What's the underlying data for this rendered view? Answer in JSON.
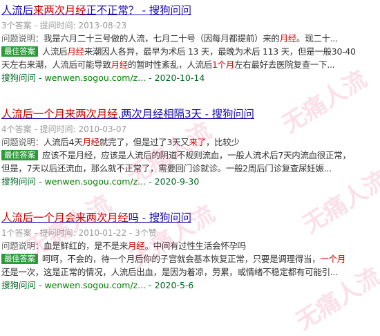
{
  "labels": {
    "question_label": "问题说明：",
    "best_answer_badge": "最佳答案",
    "ellipsis": "...",
    "dash": " - "
  },
  "watermark": "无痛人流",
  "results": [
    {
      "title_parts": [
        {
          "text": "人流后",
          "hl": false
        },
        {
          "text": "来两次月经",
          "hl": true
        },
        {
          "text": "正不正常？ - 搜狗问问",
          "hl": false
        }
      ],
      "meta": "3个答案 - 提问时间: 2013-08-23",
      "question_parts": [
        {
          "text": "我是六月二十三号做的人流，七月二十号（因每月都提前）来的",
          "hl": false
        },
        {
          "text": "月经",
          "hl": true
        },
        {
          "text": "。现二十...",
          "hl": false
        }
      ],
      "answer_line1_parts": [
        {
          "text": "人流后",
          "hl": false
        },
        {
          "text": "月经",
          "hl": true
        },
        {
          "text": "来潮因人各异，最早为术后 13 天，最晚为术后 113 天，但是一般30-40",
          "hl": false
        }
      ],
      "answer_line2_parts": [
        {
          "text": "天左右来潮，人流后可能导致",
          "hl": false
        },
        {
          "text": "月经",
          "hl": true
        },
        {
          "text": "的暂时性紊乱，人流后",
          "hl": false
        },
        {
          "text": "1个月",
          "hl": true
        },
        {
          "text": "左右最好去医院复查一下...",
          "hl": false
        }
      ],
      "source_site": "搜狗问问",
      "source_url": "wenwen.sogou.com/z...",
      "source_date": "2020-10-14"
    },
    {
      "title_parts": [
        {
          "text": "人流后一个月来两次月经",
          "hl": true
        },
        {
          "text": ",两次月经相隔3天 - 搜狗问问",
          "hl": false
        }
      ],
      "meta": "4个答案 - 提问时间: 2010-03-07",
      "question_parts": [
        {
          "text": "人流后4天",
          "hl": false
        },
        {
          "text": "月经",
          "hl": true
        },
        {
          "text": "就完了，但是过了3天又",
          "hl": false
        },
        {
          "text": "来了",
          "hl": true
        },
        {
          "text": "，比较少",
          "hl": false
        }
      ],
      "answer_line1_parts": [
        {
          "text": "应该不是月经，应该是人流后的阴道不规则流血，一般人流术后7天内流血很正常，",
          "hl": false
        }
      ],
      "answer_line2_parts": [
        {
          "text": "但是，7天以后还流血，那么就不正常了，需要回门诊就诊。一般2周后门诊复查尿妊娠...",
          "hl": false
        }
      ],
      "source_site": "搜狗问问",
      "source_url": "wenwen.sogou.com/z...",
      "source_date": "2020-9-30"
    },
    {
      "title_parts": [
        {
          "text": "人流后一个月会来两次月经",
          "hl": true
        },
        {
          "text": "吗 - 搜狗问问",
          "hl": false
        }
      ],
      "meta": "1个答案 - 提问时间: 2010-01-22 - 3个赞",
      "question_parts": [
        {
          "text": "血是鲜红的，是不是来",
          "hl": false
        },
        {
          "text": "月经",
          "hl": true
        },
        {
          "text": "。中间有过性生活会怀孕吗",
          "hl": false
        }
      ],
      "answer_line1_parts": [
        {
          "text": "呵呵，不会的，待一个月后你的子宫就会基本恢复正常，只要是调理得当，",
          "hl": false
        },
        {
          "text": "一个月",
          "hl": true
        }
      ],
      "answer_line2_parts": [
        {
          "text": "还是一次，这是正常的情况，人流后出血，是因为着凉，劳累，或情绪不稳定都有可能引...",
          "hl": false
        }
      ],
      "source_site": "搜狗问问",
      "source_url": "wenwen.sogou.com/z...",
      "source_date": "2020-5-6"
    }
  ]
}
